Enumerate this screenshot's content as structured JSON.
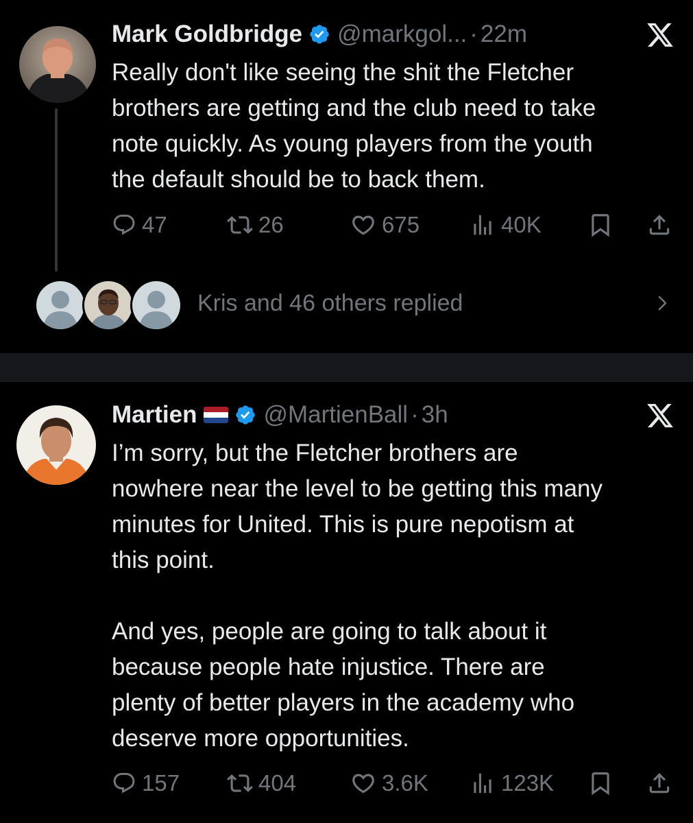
{
  "tweets": [
    {
      "author": {
        "name": "Mark Goldbridge",
        "handle": "@markgol...",
        "verified": true,
        "avatar": "avatar-photo-bald-man"
      },
      "time": "22m",
      "platform_icon": "x-logo-icon",
      "text": "Really don't like seeing the shit the Fletcher\nbrothers are getting and the club need to take\nnote quickly. As young players from the youth\nthe default should be to back them.",
      "stats": {
        "replies": "47",
        "reposts": "26",
        "likes": "675",
        "views": "40K"
      },
      "replies_summary": {
        "text": "Kris and 46 others replied",
        "avatars": [
          "default-avatar-icon",
          "avatar-photo-man",
          "default-avatar-icon"
        ]
      }
    },
    {
      "author": {
        "name": "Martien",
        "handle": "@MartienBall",
        "verified": true,
        "flag": "netherlands-flag-icon",
        "avatar": "avatar-photo-footballer"
      },
      "time": "3h",
      "platform_icon": "x-logo-icon",
      "text": "I’m sorry, but the Fletcher brothers are\nnowhere near the level to be getting this many\nminutes for United. This is pure nepotism at\nthis point.\n\nAnd yes, people are going to talk about it\nbecause people hate injustice. There are\nplenty of better players in the academy who\ndeserve more opportunities.",
      "stats": {
        "replies": "157",
        "reposts": "404",
        "likes": "3.6K",
        "views": "123K"
      }
    }
  ],
  "colors": {
    "background": "#000000",
    "text": "#e7e9ea",
    "secondary": "#71767b",
    "verified": "#1d9bf0",
    "separator": "#16181c"
  }
}
